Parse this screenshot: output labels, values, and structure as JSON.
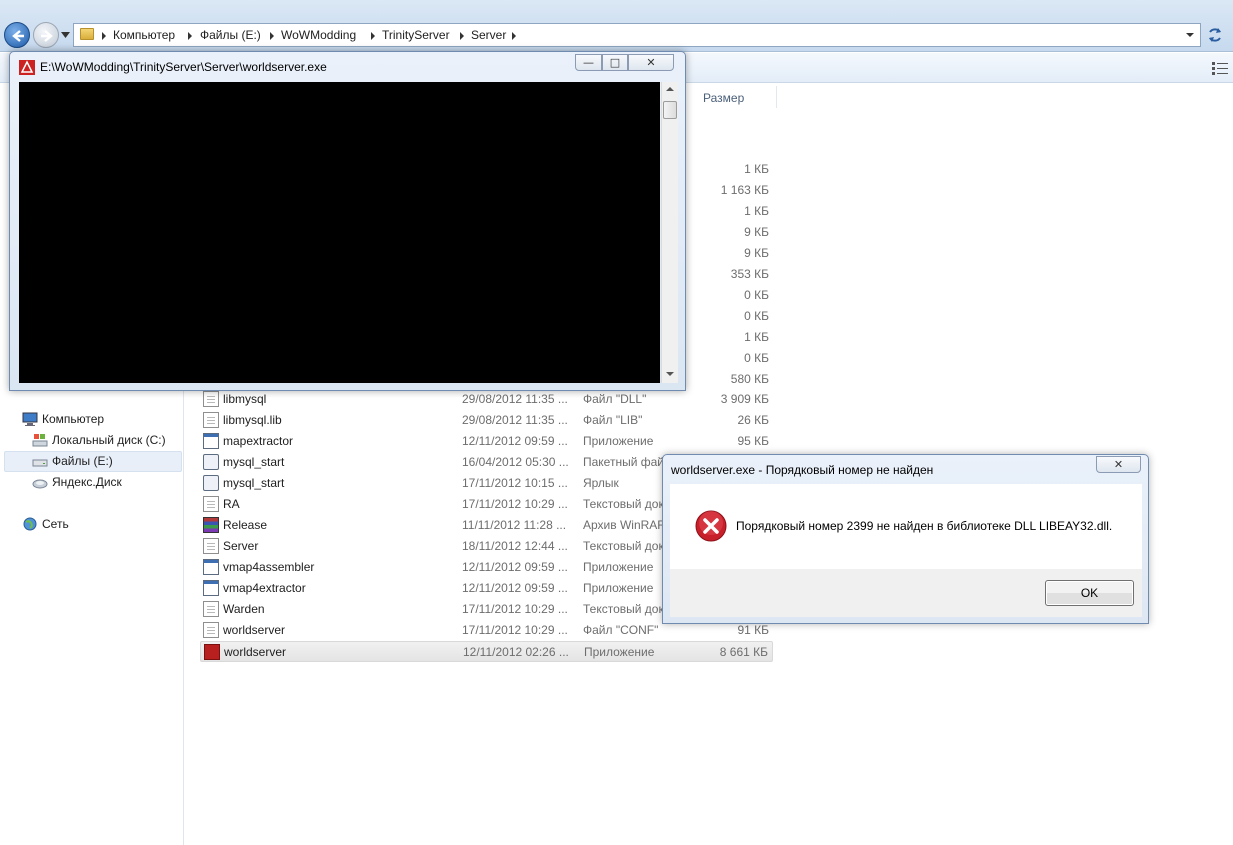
{
  "breadcrumb": [
    "Компьютер",
    "Файлы (E:)",
    "WoWModding",
    "TrinityServer",
    "Server"
  ],
  "columns": {
    "size": "Размер"
  },
  "nav_pane": {
    "computer": "Компьютер",
    "local_disk": "Локальный диск (C:)",
    "files_disk": "Файлы (E:)",
    "yandex": "Яндекс.Диск",
    "network": "Сеть"
  },
  "hidden_sizes": [
    "1 КБ",
    "1 163 КБ",
    "1 КБ",
    "9 КБ",
    "9 КБ",
    "353 КБ",
    "0 КБ",
    "0 КБ",
    "1 КБ",
    "0 КБ",
    "580 КБ"
  ],
  "files": [
    {
      "name": "libmysql",
      "date": "29/08/2012 11:35 ...",
      "type": "Файл \"DLL\"",
      "size": "3 909 КБ",
      "icon": "doc"
    },
    {
      "name": "libmysql.lib",
      "date": "29/08/2012 11:35 ...",
      "type": "Файл \"LIB\"",
      "size": "26 КБ",
      "icon": "doc"
    },
    {
      "name": "mapextractor",
      "date": "12/11/2012 09:59 ...",
      "type": "Приложение",
      "size": "95 КБ",
      "icon": "app"
    },
    {
      "name": "mysql_start",
      "date": "16/04/2012 05:30 ...",
      "type": "Пакетный фай",
      "size": "",
      "icon": "bat"
    },
    {
      "name": "mysql_start",
      "date": "17/11/2012 10:15 ...",
      "type": "Ярлык",
      "size": "",
      "icon": "bat"
    },
    {
      "name": "RA",
      "date": "17/11/2012 10:29 ...",
      "type": "Текстовый док",
      "size": "",
      "icon": "doc"
    },
    {
      "name": "Release",
      "date": "11/11/2012 11:28 ...",
      "type": "Архив WinRAR",
      "size": "",
      "icon": "rar"
    },
    {
      "name": "Server",
      "date": "18/11/2012 12:44 ...",
      "type": "Текстовый док",
      "size": "",
      "icon": "doc"
    },
    {
      "name": "vmap4assembler",
      "date": "12/11/2012 09:59 ...",
      "type": "Приложение",
      "size": "",
      "icon": "app"
    },
    {
      "name": "vmap4extractor",
      "date": "12/11/2012 09:59 ...",
      "type": "Приложение",
      "size": "",
      "icon": "app"
    },
    {
      "name": "Warden",
      "date": "17/11/2012 10:29 ...",
      "type": "Текстовый док",
      "size": "",
      "icon": "doc"
    },
    {
      "name": "worldserver",
      "date": "17/11/2012 10:29 ...",
      "type": "Файл \"CONF\"",
      "size": "91 КБ",
      "icon": "doc"
    },
    {
      "name": "worldserver",
      "date": "12/11/2012 02:26 ...",
      "type": "Приложение",
      "size": "8 661 КБ",
      "icon": "wow"
    }
  ],
  "console": {
    "title": "E:\\WoWModding\\TrinityServer\\Server\\worldserver.exe",
    "min_glyph": "—",
    "max_glyph": "□",
    "close_glyph": "✕"
  },
  "dialog": {
    "title": "worldserver.exe - Порядковый номер не найден",
    "message": "Порядковый номер 2399 не найден в библиотеке DLL LIBEAY32.dll.",
    "ok_label": "OK",
    "close_glyph": "✕"
  }
}
